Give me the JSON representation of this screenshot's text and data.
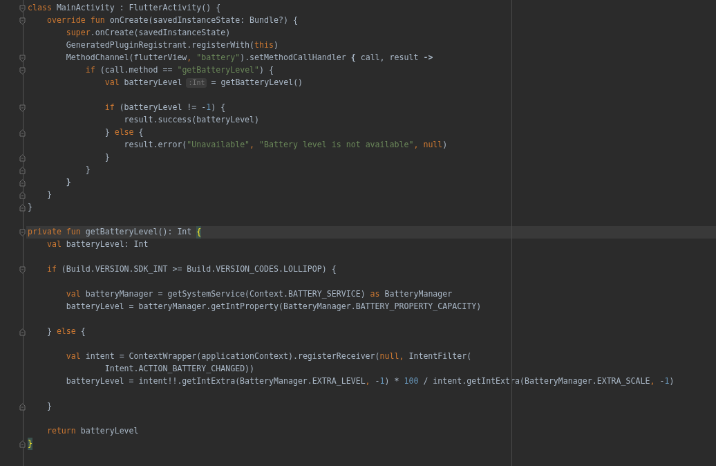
{
  "lines": [
    {
      "fold": {
        "kind": "start"
      },
      "current": false,
      "tokens": [
        {
          "kind": "kw",
          "text": "class"
        },
        {
          "kind": "txt",
          "text": " MainActivity : FlutterActivity() {"
        }
      ]
    },
    {
      "fold": {
        "kind": "start"
      },
      "current": false,
      "tokens": [
        {
          "kind": "kw",
          "text": "    override fun"
        },
        {
          "kind": "txt",
          "text": " onCreate(savedInstanceState: Bundle?) {"
        }
      ]
    },
    {
      "current": false,
      "tokens": [
        {
          "kind": "kw",
          "text": "        super"
        },
        {
          "kind": "txt",
          "text": ".onCreate(savedInstanceState)"
        }
      ]
    },
    {
      "current": false,
      "tokens": [
        {
          "kind": "txt",
          "text": "        GeneratedPluginRegistrant.registerWith("
        },
        {
          "kind": "kw",
          "text": "this"
        },
        {
          "kind": "txt",
          "text": ")"
        }
      ]
    },
    {
      "fold": {
        "kind": "start"
      },
      "current": false,
      "tokens": [
        {
          "kind": "txt",
          "text": "        MethodChannel(flutterView"
        },
        {
          "kind": "kw",
          "text": ", "
        },
        {
          "kind": "str",
          "text": "\"battery\""
        },
        {
          "kind": "txt",
          "text": ").setMethodCallHandler "
        },
        {
          "kind": "bold",
          "text": "{"
        },
        {
          "kind": "txt",
          "text": " call, result "
        },
        {
          "kind": "bold",
          "text": "->"
        }
      ]
    },
    {
      "fold": {
        "kind": "start"
      },
      "current": false,
      "tokens": [
        {
          "kind": "kw",
          "text": "            if"
        },
        {
          "kind": "txt",
          "text": " (call.method == "
        },
        {
          "kind": "str",
          "text": "\"getBatteryLevel\""
        },
        {
          "kind": "txt",
          "text": ") {"
        }
      ]
    },
    {
      "current": false,
      "tokens": [
        {
          "kind": "kw",
          "text": "                val"
        },
        {
          "kind": "txt",
          "text": " batteryLevel"
        },
        {
          "kind": "hint",
          "text": ":Int"
        },
        {
          "kind": "txt",
          "text": "= getBatteryLevel()"
        }
      ]
    },
    {
      "current": false
    },
    {
      "fold": {
        "kind": "start"
      },
      "current": false,
      "tokens": [
        {
          "kind": "kw",
          "text": "                if"
        },
        {
          "kind": "txt",
          "text": " (batteryLevel != -"
        },
        {
          "kind": "num",
          "text": "1"
        },
        {
          "kind": "txt",
          "text": ") {"
        }
      ]
    },
    {
      "current": false,
      "tokens": [
        {
          "kind": "txt",
          "text": "                    result.success(batteryLevel)"
        }
      ]
    },
    {
      "fold": {
        "kind": "end"
      },
      "current": false,
      "tokens": [
        {
          "kind": "txt",
          "text": "                } "
        },
        {
          "kind": "kw",
          "text": "else"
        },
        {
          "kind": "txt",
          "text": " {"
        }
      ]
    },
    {
      "current": false,
      "tokens": [
        {
          "kind": "txt",
          "text": "                    result.error("
        },
        {
          "kind": "str",
          "text": "\"Unavailable\""
        },
        {
          "kind": "kw",
          "text": ", "
        },
        {
          "kind": "str",
          "text": "\"Battery level is not available\""
        },
        {
          "kind": "kw",
          "text": ", null"
        },
        {
          "kind": "txt",
          "text": ")"
        }
      ]
    },
    {
      "fold": {
        "kind": "end"
      },
      "current": false,
      "tokens": [
        {
          "kind": "txt",
          "text": "                }"
        }
      ]
    },
    {
      "fold": {
        "kind": "end"
      },
      "current": false,
      "tokens": [
        {
          "kind": "txt",
          "text": "            }"
        }
      ]
    },
    {
      "fold": {
        "kind": "end"
      },
      "current": false,
      "tokens": [
        {
          "kind": "bold",
          "text": "        }"
        }
      ]
    },
    {
      "fold": {
        "kind": "end"
      },
      "current": false,
      "tokens": [
        {
          "kind": "txt",
          "text": "    }"
        }
      ]
    },
    {
      "fold": {
        "kind": "end"
      },
      "current": false,
      "tokens": [
        {
          "kind": "txt",
          "text": "}"
        }
      ]
    },
    {
      "current": false
    },
    {
      "fold": {
        "kind": "start"
      },
      "current": true,
      "tokens": [
        {
          "kind": "kw",
          "text": "private fun"
        },
        {
          "kind": "txt",
          "text": " getBatteryLevel(): Int "
        },
        {
          "kind": "brace",
          "text": "{"
        }
      ]
    },
    {
      "current": false,
      "tokens": [
        {
          "kind": "kw",
          "text": "    val"
        },
        {
          "kind": "txt",
          "text": " batteryLevel: Int"
        }
      ]
    },
    {
      "current": false
    },
    {
      "fold": {
        "kind": "start"
      },
      "current": false,
      "tokens": [
        {
          "kind": "kw",
          "text": "    if"
        },
        {
          "kind": "txt",
          "text": " (Build.VERSION.SDK_INT >= Build.VERSION_CODES.LOLLIPOP) {"
        }
      ]
    },
    {
      "current": false
    },
    {
      "current": false,
      "tokens": [
        {
          "kind": "kw",
          "text": "        val"
        },
        {
          "kind": "txt",
          "text": " batteryManager = getSystemService(Context.BATTERY_SERVICE) "
        },
        {
          "kind": "kw",
          "text": "as"
        },
        {
          "kind": "txt",
          "text": " BatteryManager"
        }
      ]
    },
    {
      "current": false,
      "tokens": [
        {
          "kind": "txt",
          "text": "        batteryLevel = batteryManager.getIntProperty(BatteryManager.BATTERY_PROPERTY_CAPACITY)"
        }
      ]
    },
    {
      "current": false
    },
    {
      "fold": {
        "kind": "end"
      },
      "current": false,
      "tokens": [
        {
          "kind": "txt",
          "text": "    } "
        },
        {
          "kind": "kw",
          "text": "else"
        },
        {
          "kind": "txt",
          "text": " {"
        }
      ]
    },
    {
      "current": false
    },
    {
      "current": false,
      "tokens": [
        {
          "kind": "kw",
          "text": "        val"
        },
        {
          "kind": "txt",
          "text": " intent = ContextWrapper(applicationContext).registerReceiver("
        },
        {
          "kind": "kw",
          "text": "null,"
        },
        {
          "kind": "txt",
          "text": " IntentFilter("
        }
      ]
    },
    {
      "current": false,
      "tokens": [
        {
          "kind": "txt",
          "text": "                Intent.ACTION_BATTERY_CHANGED))"
        }
      ]
    },
    {
      "current": false,
      "tokens": [
        {
          "kind": "txt",
          "text": "        batteryLevel = intent!!.getIntExtra(BatteryManager.EXTRA_LEVEL"
        },
        {
          "kind": "kw",
          "text": ","
        },
        {
          "kind": "txt",
          "text": " -"
        },
        {
          "kind": "num",
          "text": "1"
        },
        {
          "kind": "txt",
          "text": ") * "
        },
        {
          "kind": "num",
          "text": "100"
        },
        {
          "kind": "txt",
          "text": " / intent.getIntExtra(BatteryManager.EXTRA_SCALE"
        },
        {
          "kind": "kw",
          "text": ","
        },
        {
          "kind": "txt",
          "text": " -"
        },
        {
          "kind": "num",
          "text": "1"
        },
        {
          "kind": "txt",
          "text": ")"
        }
      ]
    },
    {
      "current": false
    },
    {
      "fold": {
        "kind": "end"
      },
      "current": false,
      "tokens": [
        {
          "kind": "txt",
          "text": "    }"
        }
      ]
    },
    {
      "current": false
    },
    {
      "current": false,
      "tokens": [
        {
          "kind": "kw",
          "text": "    return"
        },
        {
          "kind": "txt",
          "text": " batteryLevel"
        }
      ]
    },
    {
      "fold": {
        "kind": "end"
      },
      "current": false,
      "tokens": [
        {
          "kind": "brace",
          "text": "}"
        }
      ]
    }
  ]
}
